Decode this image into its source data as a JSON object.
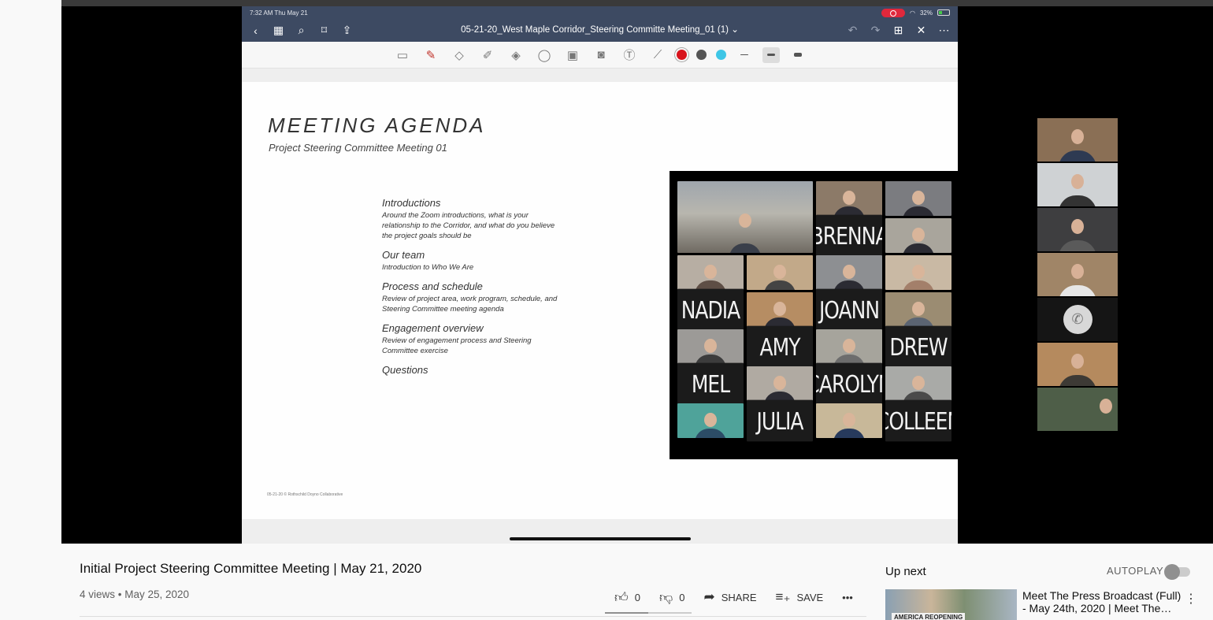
{
  "ipad": {
    "status_time": "7:32 AM   Thu May 21",
    "battery": "32%",
    "doc_title": "05-21-20_West Maple Corridor_Steering Committe Meeting_01 (1)",
    "doc_title_chevron": "⌄"
  },
  "slide": {
    "title": "MEETING AGENDA",
    "subtitle": "Project Steering Committee Meeting 01",
    "agenda": [
      {
        "heading": "Introductions",
        "desc": "Around the Zoom introductions, what is your relationship to the Corridor, and what do you believe the project goals should be"
      },
      {
        "heading": "Our team",
        "desc": "Introduction to Who We Are"
      },
      {
        "heading": "Process and schedule",
        "desc": "Review of project area, work program, schedule, and Steering Committee meeting agenda"
      },
      {
        "heading": "Engagement overview",
        "desc": "Review of engagement process and Steering Committee exercise"
      },
      {
        "heading": "Questions",
        "desc": ""
      }
    ],
    "footer": "05-21-20 © Rothschild Doyno Collaborative"
  },
  "gallery_names": {
    "brenna": "BRENNA",
    "nadia": "NADIA",
    "joann": "JOANN",
    "amy": "AMY",
    "drew": "DREW",
    "mel": "MEL",
    "carolyn": "CAROLYN",
    "julia": "JULIA",
    "colleen": "COLLEEN"
  },
  "video": {
    "title": "Initial Project Steering Committee Meeting | May 21, 2020",
    "meta": "4 views • May 25, 2020",
    "likes": "0",
    "dislikes": "0",
    "share_label": "SHARE",
    "save_label": "SAVE",
    "more_label": "•••"
  },
  "sidebar": {
    "up_next": "Up next",
    "autoplay": "AUTOPLAY",
    "autoplay_on": false,
    "rec_title": "Meet The Press Broadcast (Full) - May 24th, 2020 | Meet The…",
    "thumb_label": "AMERICA REOPENING"
  },
  "colors": {
    "ipad_nav": "#3d4a62",
    "pen_red": "#d8131c",
    "pen_grey": "#555555",
    "pen_cyan": "#3ec6e6"
  }
}
